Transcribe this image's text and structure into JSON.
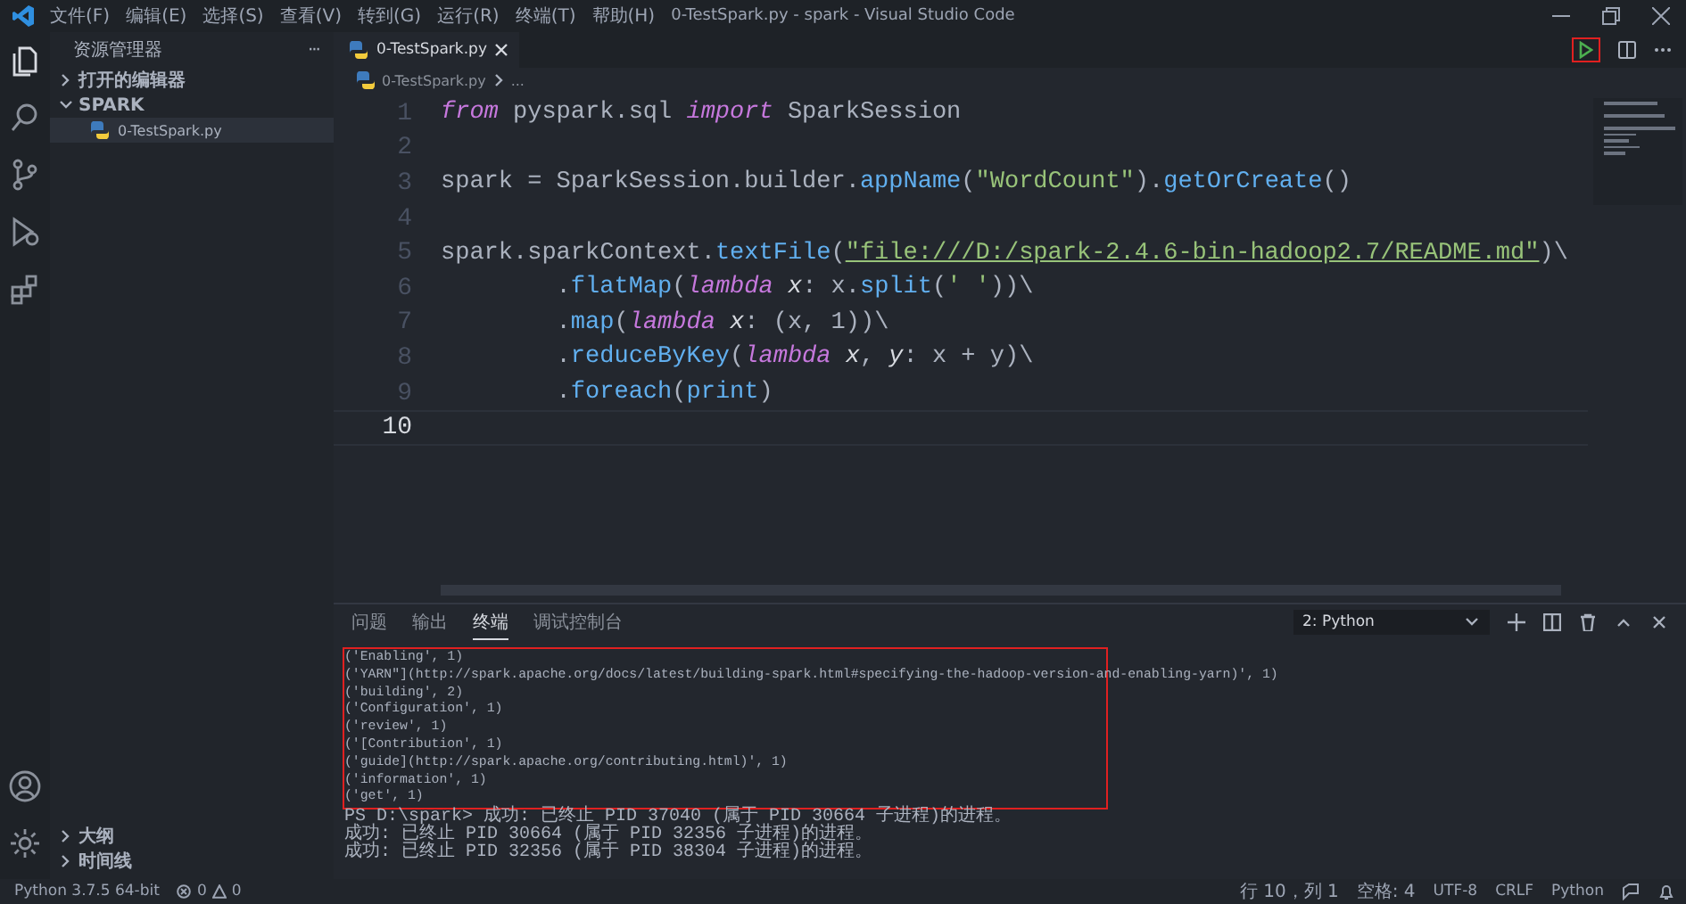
{
  "window": {
    "title": "0-TestSpark.py - spark - Visual Studio Code"
  },
  "menu": [
    "文件(F)",
    "编辑(E)",
    "选择(S)",
    "查看(V)",
    "转到(G)",
    "运行(R)",
    "终端(T)",
    "帮助(H)"
  ],
  "sidebar": {
    "title": "资源管理器",
    "more": "···",
    "sections": [
      {
        "label": "打开的编辑器",
        "expanded": false
      },
      {
        "label": "SPARK",
        "expanded": true,
        "children": [
          {
            "label": "0-TestSpark.py",
            "selected": true
          }
        ]
      }
    ],
    "bottom_sections": [
      {
        "label": "大纲",
        "expanded": false
      },
      {
        "label": "时间线",
        "expanded": false
      }
    ]
  },
  "tabs": [
    {
      "label": "0-TestSpark.py",
      "selected": true
    }
  ],
  "breadcrumb": [
    "0-TestSpark.py",
    "..."
  ],
  "editor": {
    "lines": [
      {
        "number": "1",
        "current": false,
        "tokens": [
          {
            "kind": "keyword",
            "text": "from"
          },
          {
            "kind": "plain",
            "text": " pyspark.sql "
          },
          {
            "kind": "keyword",
            "text": "import"
          },
          {
            "kind": "plain",
            "text": " SparkSession"
          }
        ]
      },
      {
        "number": "2",
        "current": false
      },
      {
        "number": "3",
        "current": false,
        "tokens": [
          {
            "kind": "plain",
            "text": "spark = SparkSession.builder."
          },
          {
            "kind": "function",
            "text": "appName"
          },
          {
            "kind": "plain",
            "text": "("
          },
          {
            "kind": "string",
            "text": "\"WordCount\""
          },
          {
            "kind": "plain",
            "text": ")."
          },
          {
            "kind": "function",
            "text": "getOrCreate"
          },
          {
            "kind": "plain",
            "text": "()"
          }
        ]
      },
      {
        "number": "4",
        "current": false
      },
      {
        "number": "5",
        "current": false,
        "tokens": [
          {
            "kind": "plain",
            "text": "spark.sparkContext."
          },
          {
            "kind": "function",
            "text": "textFile"
          },
          {
            "kind": "plain",
            "text": "("
          },
          {
            "kind": "link",
            "text": "\"file:///D:/spark-2.4.6-bin-hadoop2.7/README.md\""
          },
          {
            "kind": "plain",
            "text": ")\\"
          }
        ]
      },
      {
        "number": "6",
        "current": false,
        "tokens": [
          {
            "kind": "plain",
            "text": "        ."
          },
          {
            "kind": "function",
            "text": "flatMap"
          },
          {
            "kind": "plain",
            "text": "("
          },
          {
            "kind": "keyword",
            "text": "lambda"
          },
          {
            "kind": "param",
            "text": " x"
          },
          {
            "kind": "plain",
            "text": ": x."
          },
          {
            "kind": "function",
            "text": "split"
          },
          {
            "kind": "plain",
            "text": "("
          },
          {
            "kind": "string",
            "text": "' '"
          },
          {
            "kind": "plain",
            "text": "))\\"
          }
        ]
      },
      {
        "number": "7",
        "current": false,
        "tokens": [
          {
            "kind": "plain",
            "text": "        ."
          },
          {
            "kind": "function",
            "text": "map"
          },
          {
            "kind": "plain",
            "text": "("
          },
          {
            "kind": "keyword",
            "text": "lambda"
          },
          {
            "kind": "param",
            "text": " x"
          },
          {
            "kind": "plain",
            "text": ": (x, 1))\\"
          }
        ]
      },
      {
        "number": "8",
        "current": false,
        "tokens": [
          {
            "kind": "plain",
            "text": "        ."
          },
          {
            "kind": "function",
            "text": "reduceByKey"
          },
          {
            "kind": "plain",
            "text": "("
          },
          {
            "kind": "keyword",
            "text": "lambda"
          },
          {
            "kind": "param",
            "text": " x"
          },
          {
            "kind": "plain",
            "text": ", "
          },
          {
            "kind": "param",
            "text": "y"
          },
          {
            "kind": "plain",
            "text": ": x + y)\\"
          }
        ]
      },
      {
        "number": "9",
        "current": false,
        "tokens": [
          {
            "kind": "plain",
            "text": "        ."
          },
          {
            "kind": "function",
            "text": "foreach"
          },
          {
            "kind": "plain",
            "text": "("
          },
          {
            "kind": "function",
            "text": "print"
          },
          {
            "kind": "plain",
            "text": ")"
          }
        ]
      },
      {
        "number": "10",
        "current": true
      }
    ]
  },
  "panel": {
    "tabs": [
      {
        "label": "问题",
        "selected": false
      },
      {
        "label": "输出",
        "selected": false
      },
      {
        "label": "终端",
        "selected": true
      },
      {
        "label": "调试控制台",
        "selected": false
      }
    ],
    "terminal_selector": "2: Python",
    "highlighted_output": [
      "('Enabling', 1)",
      "('YARN\"](http://spark.apache.org/docs/latest/building-spark.html#specifying-the-hadoop-version-and-enabling-yarn)', 1)",
      "('building', 2)",
      "('Configuration', 1)",
      "('review', 1)",
      "('[Contribution', 1)",
      "('guide](http://spark.apache.org/contributing.html)', 1)",
      "('information', 1)",
      "('get', 1)"
    ],
    "output": [
      "PS D:\\spark> 成功: 已终止 PID 37040 (属于 PID 30664 子进程)的进程。",
      "成功: 已终止 PID 30664 (属于 PID 32356 子进程)的进程。",
      "成功: 已终止 PID 32356 (属于 PID 38304 子进程)的进程。"
    ]
  },
  "status_bar": {
    "interpreter": "Python 3.7.5 64-bit",
    "errors": "0",
    "warnings": "0",
    "position": "行 10，列 1",
    "indent": "空格: 4",
    "encoding": "UTF-8",
    "eol": "CRLF",
    "language": "Python"
  }
}
